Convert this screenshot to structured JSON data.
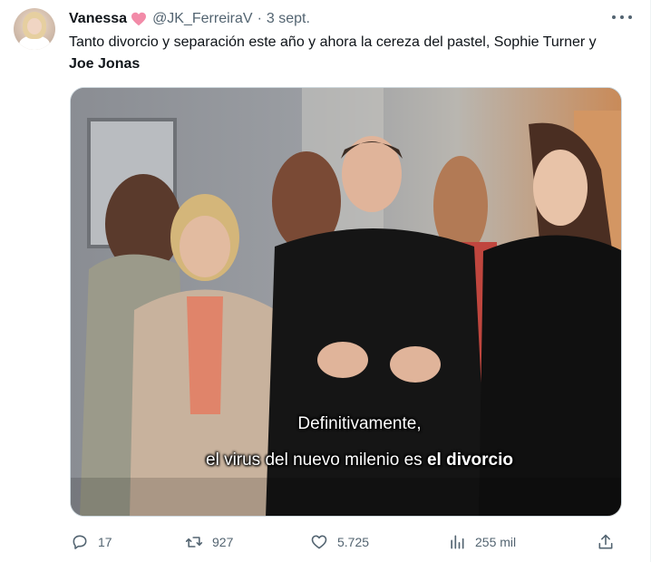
{
  "tweet": {
    "author_name": "Vanessa",
    "handle": "@JK_FerreiraV",
    "separator": "·",
    "date": "3 sept.",
    "text_plain": "Tanto divorcio y separación este año y ahora la cereza del pastel, Sophie Turner y ",
    "text_bold": "Joe Jonas",
    "heart_color": "#f28ba8"
  },
  "media": {
    "subtitle_line1": "Definitivamente,",
    "subtitle_line2_plain": "el virus del nuevo milenio es ",
    "subtitle_line2_bold": "el divorcio"
  },
  "actions": {
    "replies": "17",
    "reposts": "927",
    "likes": "5.725",
    "views": "255 mil",
    "icons": [
      "reply-icon",
      "repost-icon",
      "like-icon",
      "views-icon",
      "share-icon"
    ]
  },
  "colors": {
    "text": "#0f1419",
    "secondary": "#536471"
  }
}
